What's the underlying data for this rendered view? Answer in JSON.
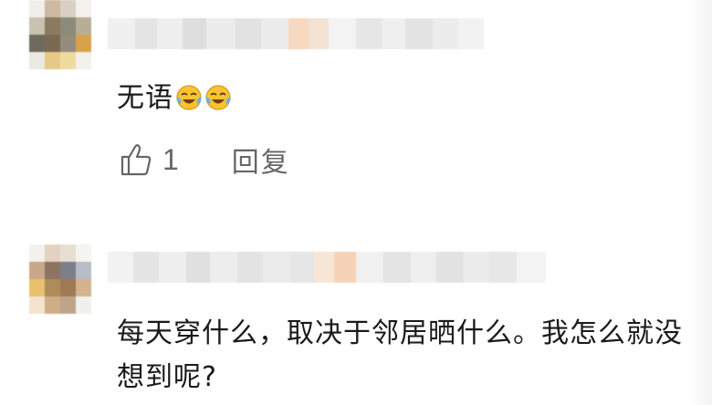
{
  "comments": [
    {
      "text": "无语",
      "emoji": [
        "laughing-crying-emoji",
        "laughing-crying-emoji"
      ],
      "likes": "1",
      "reply_label": "回复"
    },
    {
      "text": "每天穿什么，取决于邻居晒什么。我怎么就没想到呢?"
    }
  ]
}
